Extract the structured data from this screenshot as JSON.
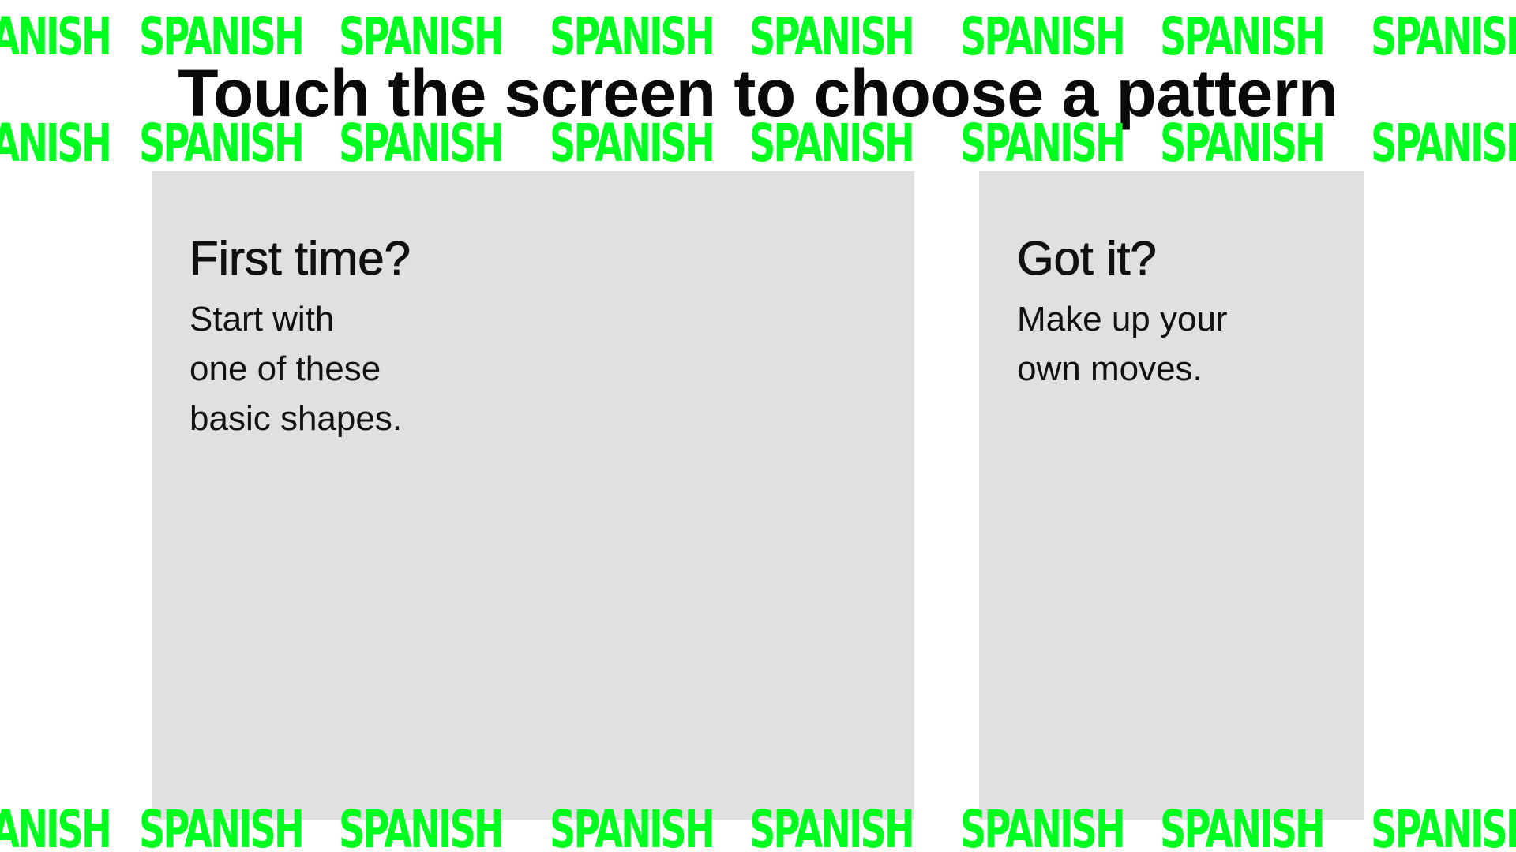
{
  "banner": {
    "word": "SPANISH",
    "color": "#00ff1e"
  },
  "title": "Touch the screen to choose a pattern",
  "cards": [
    {
      "heading": "First time?",
      "body": "Start with\none of these\nbasic shapes."
    },
    {
      "heading": "Got it?",
      "body": "Make up your\nown moves."
    }
  ]
}
